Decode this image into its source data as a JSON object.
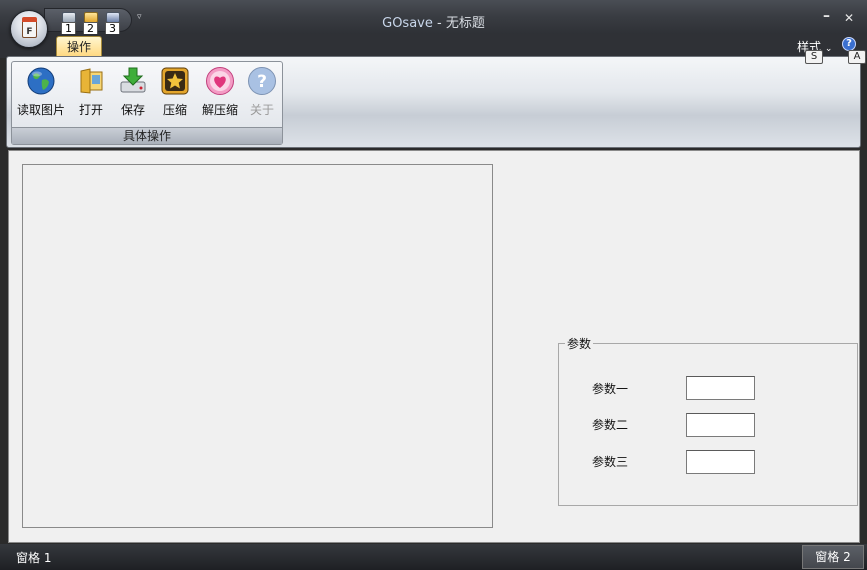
{
  "window": {
    "app_name": "GOsave",
    "separator": " - ",
    "doc_name": "无标题",
    "minimize_glyph": "–",
    "close_glyph": "✕"
  },
  "app_button": {
    "letter": "F",
    "icon": "app-menu-icon"
  },
  "quick_access": {
    "items": [
      {
        "num": "1",
        "icon": "new-doc-icon"
      },
      {
        "num": "2",
        "icon": "open-folder-icon"
      },
      {
        "num": "3",
        "icon": "save-disk-icon"
      }
    ],
    "more_glyph": "▿"
  },
  "tabs": {
    "active": "操作"
  },
  "topright": {
    "style_menu": "样式",
    "style_keytip": "S",
    "help_keytip": "A",
    "help_glyph": "?"
  },
  "ribbon": {
    "group_label": "具体操作",
    "buttons": [
      {
        "label": "读取图片",
        "icon": "globe-icon",
        "enabled": true
      },
      {
        "label": "打开",
        "icon": "folder-icon",
        "enabled": true
      },
      {
        "label": "保存",
        "icon": "download-icon",
        "enabled": true
      },
      {
        "label": "压缩",
        "icon": "star-icon",
        "enabled": true
      },
      {
        "label": "解压缩",
        "icon": "heart-icon",
        "enabled": true
      },
      {
        "label": "关于",
        "icon": "question-icon",
        "enabled": false
      }
    ]
  },
  "params": {
    "legend": "参数",
    "fields": [
      {
        "label": "参数一",
        "value": ""
      },
      {
        "label": "参数二",
        "value": ""
      },
      {
        "label": "参数三",
        "value": ""
      }
    ]
  },
  "status": {
    "pane1": "窗格 1",
    "pane2": "窗格 2"
  },
  "colors": {
    "active_tab": "#ffd67a",
    "frame": "#2b2b2b",
    "client_bg": "#f0f0f0"
  }
}
